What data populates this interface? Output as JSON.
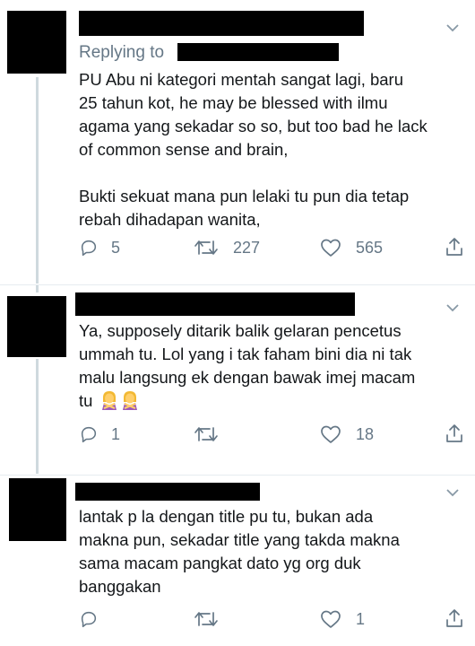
{
  "tweets": [
    {
      "replying_to": "Replying to",
      "lines": [
        "PU Abu ni kategori mentah sangat lagi, baru",
        "25 tahun kot, he may be blessed with ilmu",
        "agama yang sekadar so so, but too bad he lack",
        "of common sense and brain,",
        "",
        "Bukti sekuat mana pun lelaki tu pun dia tetap",
        "rebah dihadapan wanita,"
      ],
      "replies": "5",
      "retweets": "227",
      "likes": "565"
    },
    {
      "lines": [
        "Ya, supposely ditarik balik gelaran pencetus",
        "ummah tu. Lol yang i tak faham bini dia ni tak",
        "malu langsung ek dengan bawak imej macam",
        "tu"
      ],
      "emojis": [
        "person-gesturing-no-emoji",
        "person-gesturing-no-emoji"
      ],
      "replies": "1",
      "retweets": "",
      "likes": "18"
    },
    {
      "lines": [
        "lantak p la dengan title pu tu, bukan ada",
        "makna pun, sekadar title yang takda makna",
        "sama macam pangkat dato yg org duk",
        "banggakan"
      ],
      "replies": "",
      "retweets": "",
      "likes": "1"
    }
  ],
  "colors": {
    "text": "#14171a",
    "secondary": "#657786",
    "thread_line": "#cfd9de",
    "divider": "#e6ecf0"
  },
  "icons": [
    "reply-icon",
    "retweet-icon",
    "like-icon",
    "share-icon",
    "chevron-down-icon"
  ]
}
